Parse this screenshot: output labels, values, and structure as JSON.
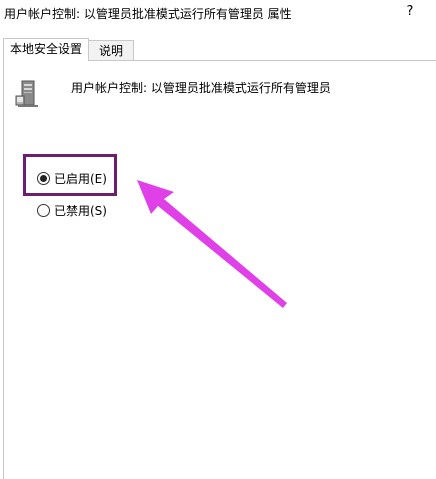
{
  "window": {
    "title": "用户帐户控制: 以管理员批准模式运行所有管理员 属性",
    "help_label": "?"
  },
  "tabs": [
    {
      "label": "本地安全设置",
      "active": true
    },
    {
      "label": "说明",
      "active": false
    }
  ],
  "policy": {
    "name": "用户帐户控制: 以管理员批准模式运行所有管理员",
    "icon": "server-computer-icon"
  },
  "options": [
    {
      "label": "已启用(E)",
      "checked": true
    },
    {
      "label": "已禁用(S)",
      "checked": false
    }
  ],
  "colors": {
    "highlight_box": "#6e1e6e",
    "arrow": "#e040e8",
    "tab_border": "#c8c8c8"
  }
}
